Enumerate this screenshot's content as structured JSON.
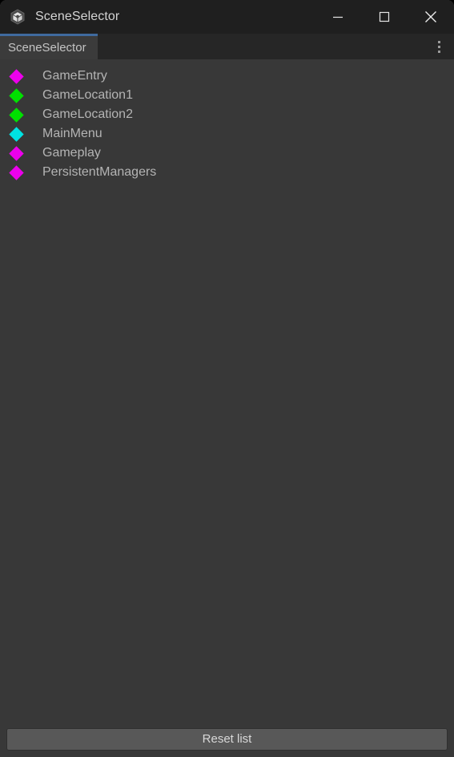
{
  "window": {
    "title": "SceneSelector",
    "app_icon": "unity-logo-icon",
    "controls": {
      "minimize_label": "Minimize",
      "maximize_label": "Maximize",
      "close_label": "Close"
    }
  },
  "tabbar": {
    "active_tab": "SceneSelector",
    "accent_color": "#3f6a9e",
    "menu_icon": "kebab-menu-icon"
  },
  "scene_list": {
    "items": [
      {
        "name": "GameEntry",
        "bullet_color": "#ec00ec"
      },
      {
        "name": "GameLocation1",
        "bullet_color": "#00e000"
      },
      {
        "name": "GameLocation2",
        "bullet_color": "#00e000"
      },
      {
        "name": "MainMenu",
        "bullet_color": "#00e2e2"
      },
      {
        "name": "Gameplay",
        "bullet_color": "#ec00ec"
      },
      {
        "name": "PersistentManagers",
        "bullet_color": "#ec00ec"
      }
    ]
  },
  "footer": {
    "reset_button_label": "Reset list"
  },
  "colors": {
    "titlebar_bg": "#1f1f1f",
    "tabbar_bg": "#262626",
    "content_bg": "#383838",
    "tab_bg": "#3b3b3b",
    "text": "#b4b4b4",
    "button_bg": "#585858"
  }
}
